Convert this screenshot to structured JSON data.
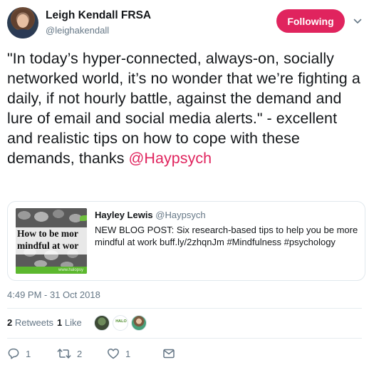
{
  "author": {
    "name": "Leigh Kendall FRSA",
    "handle": "@leighakendall"
  },
  "follow_button": {
    "label": "Following",
    "color": "#e0245e"
  },
  "tweet": {
    "text": "\"In today’s hyper-connected, always-on, socially networked world, it’s no wonder that we’re fighting a daily, if not hourly battle, against the demand and lure of email and social media alerts.\" - excellent and realistic tips on how to cope with these demands, thanks ",
    "mention": "@Haypsych",
    "timestamp": "4:49 PM - 31 Oct 2018"
  },
  "quoted": {
    "name": "Hayley Lewis",
    "handle": "@Haypsych",
    "text": "NEW BLOG POST: Six research-based tips to help you be more mindful at work buff.ly/2zhqnJm #Mindfulness #psychology",
    "thumbnail": {
      "line1": "How to be mor",
      "line2": "mindful at wor",
      "url": "www.halopsy"
    }
  },
  "stats": {
    "retweets_count": "2",
    "retweets_label": "Retweets",
    "likes_count": "1",
    "likes_label": "Like",
    "liker_badge": "HALO"
  },
  "actions": {
    "reply_count": "1",
    "retweet_count": "2",
    "like_count": "1"
  },
  "colors": {
    "accent": "#e0245e",
    "text": "#14171a",
    "muted": "#657786",
    "border": "#e1e8ed"
  },
  "icons": [
    "chevron-down-icon",
    "reply-icon",
    "retweet-icon",
    "heart-icon",
    "envelope-icon"
  ]
}
